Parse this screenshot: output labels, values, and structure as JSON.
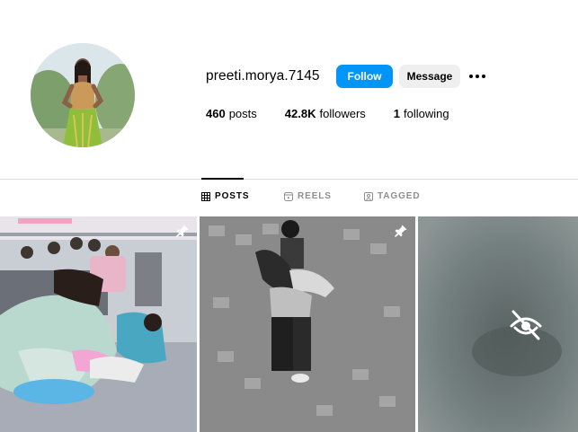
{
  "profile": {
    "username": "preeti.morya.7145",
    "follow_label": "Follow",
    "message_label": "Message",
    "stats": [
      {
        "value": "460",
        "label": "posts"
      },
      {
        "value": "42.8K",
        "label": "followers"
      },
      {
        "value": "1",
        "label": "following"
      }
    ]
  },
  "tabs": [
    {
      "label": "POSTS",
      "icon": "grid-icon",
      "active": true
    },
    {
      "label": "REELS",
      "icon": "reels-icon",
      "active": false
    },
    {
      "label": "TAGGED",
      "icon": "tagged-icon",
      "active": false
    }
  ],
  "posts": [
    {
      "type": "photo",
      "pinned": true,
      "description_icon": "pin-icon"
    },
    {
      "type": "photo",
      "pinned": true,
      "description_icon": "pin-icon"
    },
    {
      "type": "hidden",
      "pinned": false,
      "description_icon": "eye-slash-icon"
    }
  ],
  "colors": {
    "accent": "#0095f6",
    "secondary_button": "#efefef",
    "muted_text": "#8e8e8e",
    "divider": "#dbdbdb"
  }
}
